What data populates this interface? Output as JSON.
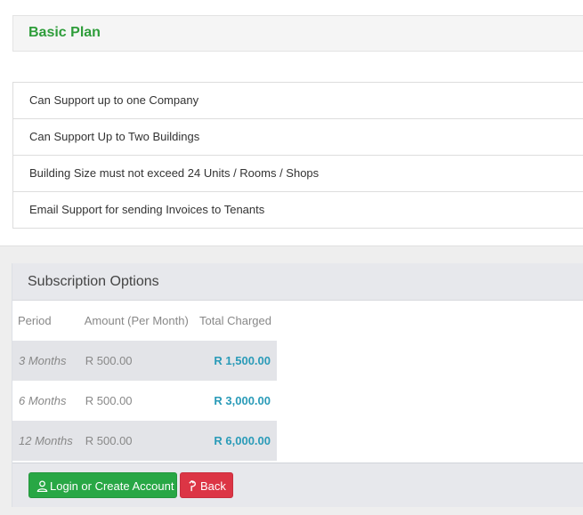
{
  "plan": {
    "title": "Basic Plan",
    "features": [
      "Can Support up to one Company",
      "Can Support Up to Two Buildings",
      "Building Size must not exceed 24 Units / Rooms / Shops",
      "Email Support for sending Invoices to Tenants"
    ]
  },
  "subscription": {
    "title": "Subscription Options",
    "columns": [
      "Period",
      "Amount (Per Month)",
      "Total Charged"
    ],
    "rows": [
      {
        "period": "3 Months",
        "amount": "R 500.00",
        "total": "R 1,500.00"
      },
      {
        "period": "6 Months",
        "amount": "R 500.00",
        "total": "R 3,000.00"
      },
      {
        "period": "12 Months",
        "amount": "R 500.00",
        "total": "R 6,000.00"
      }
    ]
  },
  "actions": {
    "login_label": "Login or Create Account",
    "login_icon": "user-icon",
    "back_label": "Back",
    "back_icon": "back-arrow-icon"
  },
  "colors": {
    "plan_title": "#2e9d3a",
    "total": "#2a9bb8",
    "login_button": "#28a745",
    "back_button": "#dc3545"
  }
}
